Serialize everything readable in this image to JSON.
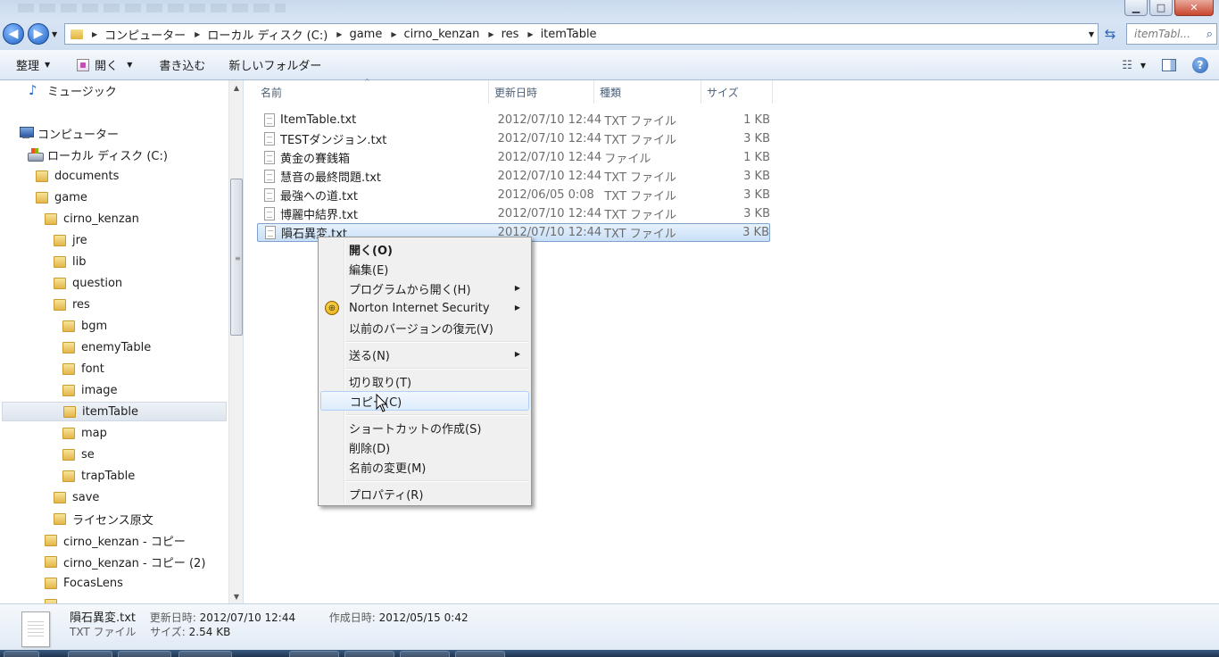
{
  "window": {
    "minimize_glyph": "▁",
    "maximize_glyph": "□",
    "close_glyph": "✕"
  },
  "address": {
    "crumbs": [
      "コンピューター",
      "ローカル ディスク (C:)",
      "game",
      "cirno_kenzan",
      "res",
      "itemTable"
    ],
    "search_placeholder": "itemTabl..."
  },
  "toolbar": {
    "organize": "整理",
    "open": "開く",
    "burn": "書き込む",
    "new_folder": "新しいフォルダー"
  },
  "nav": {
    "items": [
      "ミュージック",
      "コンピューター",
      "ローカル ディスク (C:)",
      "documents",
      "game",
      "cirno_kenzan",
      "jre",
      "lib",
      "question",
      "res",
      "bgm",
      "enemyTable",
      "font",
      "image",
      "itemTable",
      "map",
      "se",
      "trapTable",
      "save",
      "ライセンス原文",
      "cirno_kenzan - コピー",
      "cirno_kenzan - コピー (2)",
      "FocasLens"
    ]
  },
  "columns": {
    "name": "名前",
    "date": "更新日時",
    "type": "種類",
    "size": "サイズ"
  },
  "files": [
    {
      "name": "ItemTable.txt",
      "date": "2012/07/10 12:44",
      "type": "TXT ファイル",
      "size": "1 KB"
    },
    {
      "name": "TESTダンジョン.txt",
      "date": "2012/07/10 12:44",
      "type": "TXT ファイル",
      "size": "3 KB"
    },
    {
      "name": "黄金の賽銭箱",
      "date": "2012/07/10 12:44",
      "type": "ファイル",
      "size": "1 KB"
    },
    {
      "name": "慧音の最終問題.txt",
      "date": "2012/07/10 12:44",
      "type": "TXT ファイル",
      "size": "3 KB"
    },
    {
      "name": "最強への道.txt",
      "date": "2012/06/05 0:08",
      "type": "TXT ファイル",
      "size": "3 KB"
    },
    {
      "name": "博麗中結界.txt",
      "date": "2012/07/10 12:44",
      "type": "TXT ファイル",
      "size": "3 KB"
    },
    {
      "name": "隕石異変.txt",
      "date": "2012/07/10 12:44",
      "type": "TXT ファイル",
      "size": "3 KB"
    }
  ],
  "context_menu": {
    "open": "開く(O)",
    "edit": "編集(E)",
    "open_with": "プログラムから開く(H)",
    "norton": "Norton Internet Security",
    "restore": "以前のバージョンの復元(V)",
    "send_to": "送る(N)",
    "cut": "切り取り(T)",
    "copy": "コピー(C)",
    "shortcut": "ショートカットの作成(S)",
    "delete": "削除(D)",
    "rename": "名前の変更(M)",
    "properties": "プロパティ(R)"
  },
  "details": {
    "filename": "隕石異変.txt",
    "modified_label": "更新日時:",
    "modified_value": "2012/07/10 12:44",
    "created_label": "作成日時:",
    "created_value": "2012/05/15 0:42",
    "type": "TXT ファイル",
    "size_label": "サイズ:",
    "size_value": "2.54 KB"
  }
}
